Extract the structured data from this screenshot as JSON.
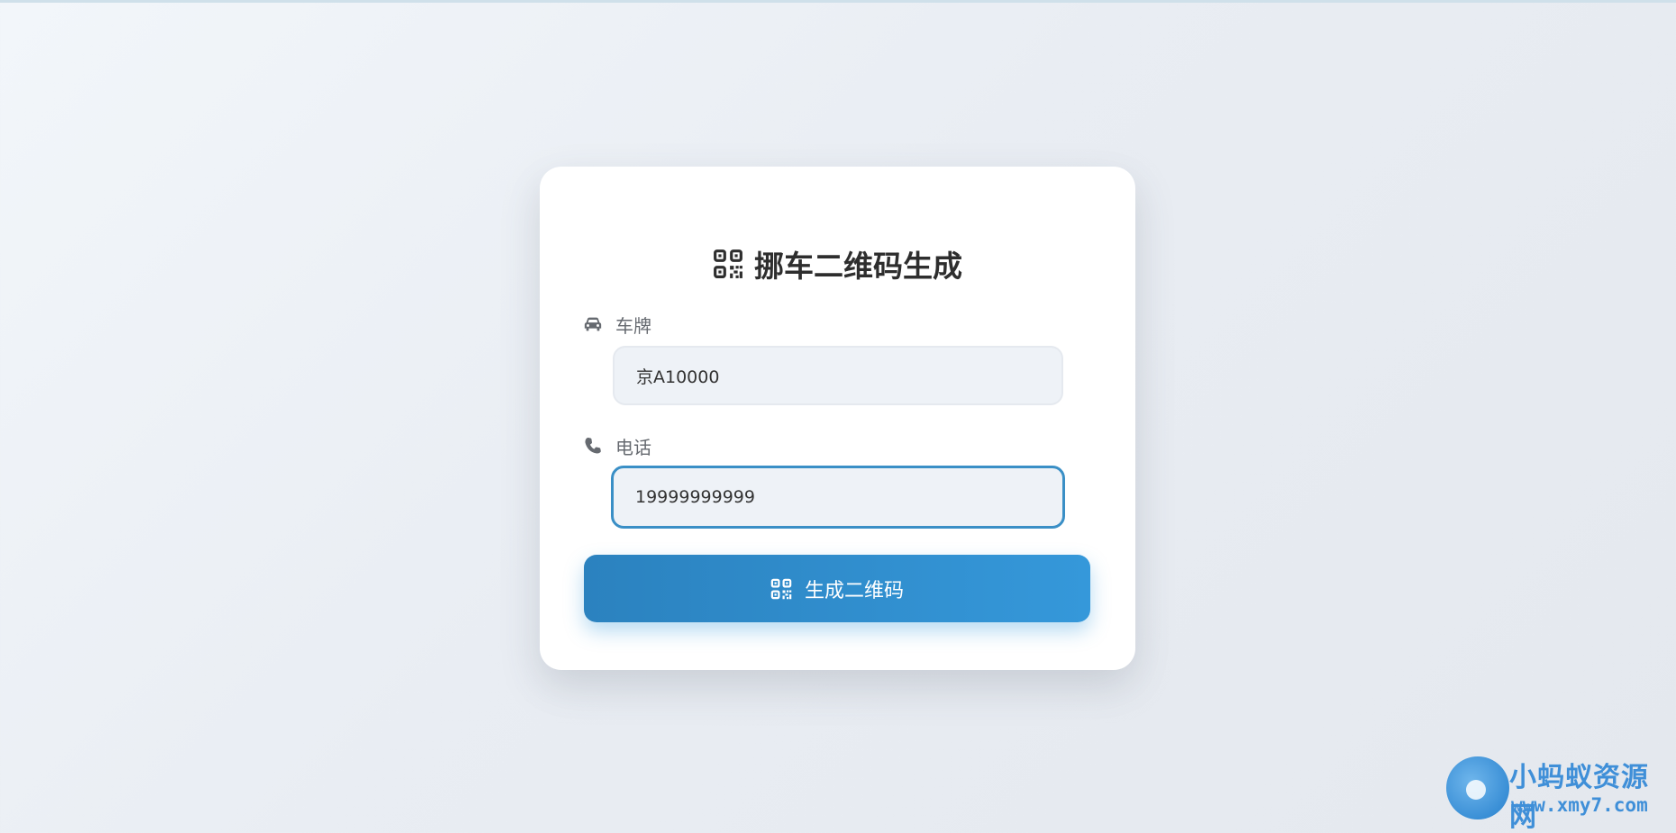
{
  "title": {
    "text": "挪车二维码生成",
    "icon": "qrcode-icon"
  },
  "form": {
    "plate": {
      "label": "车牌",
      "icon": "car-icon",
      "value": "京A10000"
    },
    "phone": {
      "label": "电话",
      "icon": "phone-icon",
      "value": "19999999999"
    },
    "submit": {
      "label": "生成二维码",
      "icon": "qrcode-icon"
    }
  },
  "watermark": {
    "name": "小蚂蚁资源网",
    "url": "www.xmy7.com"
  },
  "colors": {
    "accent": "#3598da",
    "focus_border": "#3a8fc6",
    "title_text": "#2e2e2e",
    "label_text": "#666a70",
    "watermark": "#3f8fd8"
  }
}
